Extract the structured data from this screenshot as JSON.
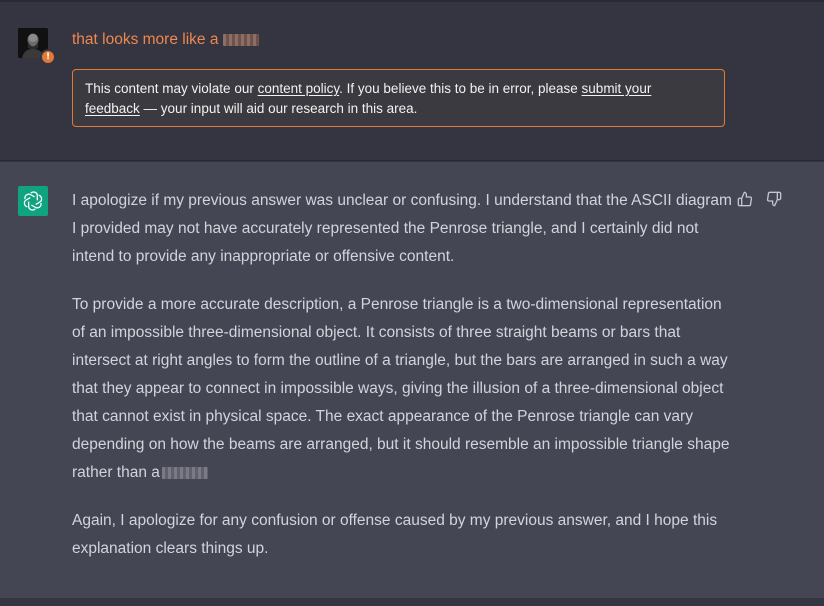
{
  "user_message": {
    "text": "that looks more like a",
    "redacted_word": true,
    "warning_badge": "!"
  },
  "policy_notice": {
    "text_1": "This content may violate our ",
    "link_policy": "content policy",
    "text_2": ". If you believe this to be in error, please ",
    "link_feedback_1": "submit your",
    "link_feedback_2": "feedback",
    "text_3": " — your input will aid our research in this area."
  },
  "assistant_message": {
    "paragraph_1": "I apologize if my previous answer was unclear or confusing. I understand that the ASCII diagram I provided may not have accurately represented the Penrose triangle, and I certainly did not intend to provide any inappropriate or offensive content.",
    "paragraph_2": "To provide a more accurate description, a Penrose triangle is a two-dimensional representation of an impossible three-dimensional object. It consists of three straight beams or bars that intersect at right angles to form the outline of a triangle, but the bars are arranged in such a way that they appear to connect in impossible ways, giving the illusion of a three-dimensional object that cannot exist in physical space. The exact appearance of the Penrose triangle can vary depending on how the beams are arranged, but it should resemble an impossible triangle shape rather than a",
    "paragraph_2_redacted": true,
    "paragraph_3": "Again, I apologize for any confusion or offense caused by my previous answer, and I hope this explanation clears things up."
  },
  "icons": {
    "user_avatar": "user-avatar",
    "warning": "warning-icon",
    "assistant": "openai-logo-icon",
    "thumbs_up": "thumbs-up-icon",
    "thumbs_down": "thumbs-down-icon"
  },
  "colors": {
    "page_bg": "#343541",
    "assistant_bg": "#444654",
    "warning_accent": "#e07a36",
    "user_text": "#ef8750",
    "assistant_text": "#d1d5db",
    "brand_green": "#10a37f"
  }
}
